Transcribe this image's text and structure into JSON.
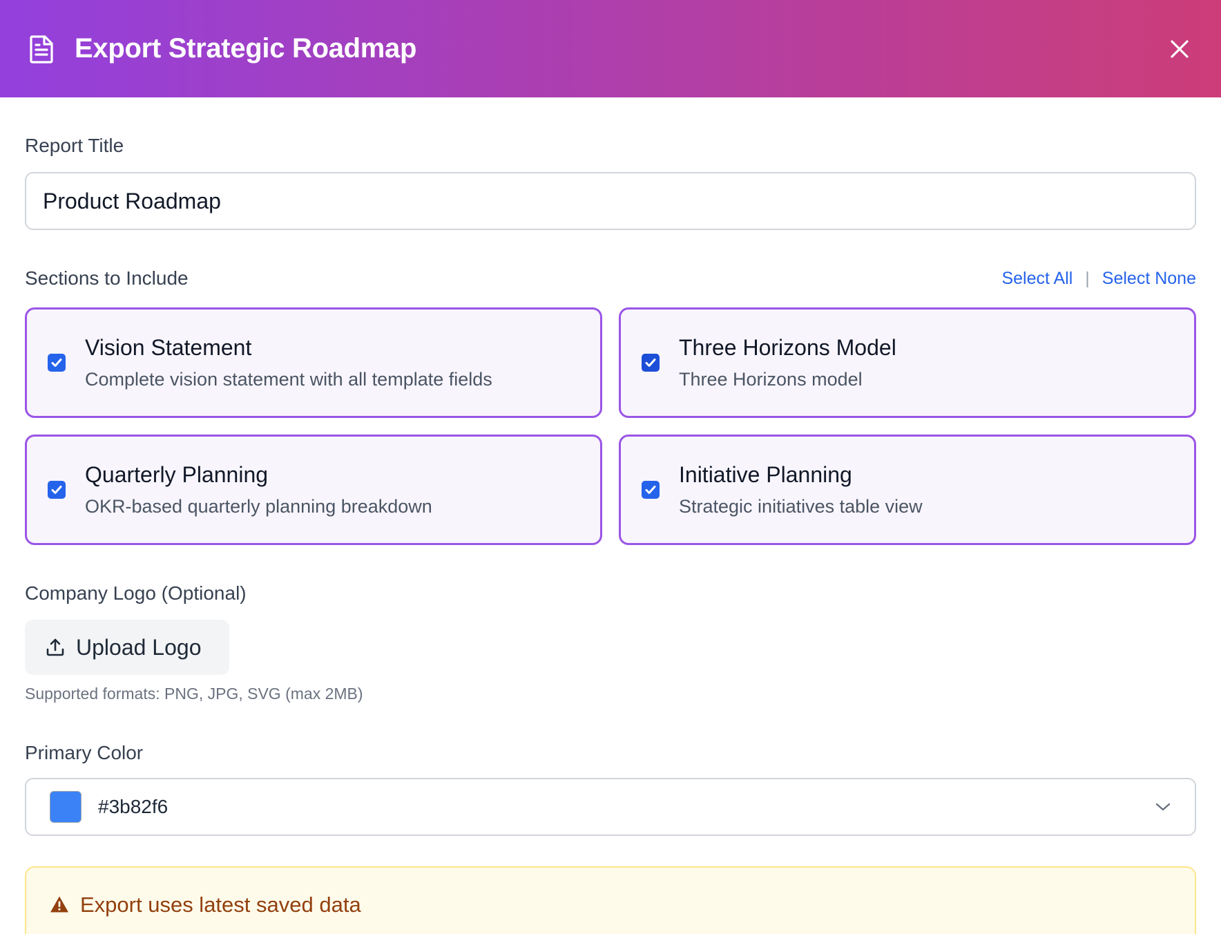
{
  "header": {
    "title": "Export Strategic Roadmap",
    "doc_icon": "document-icon",
    "close_icon": "close-icon"
  },
  "report": {
    "label": "Report Title",
    "value": "Product Roadmap"
  },
  "sections": {
    "label": "Sections to Include",
    "select_all": "Select All",
    "separator": "|",
    "select_none": "Select None",
    "items": [
      {
        "title": "Vision Statement",
        "description": "Complete vision statement with all template fields",
        "checked": true
      },
      {
        "title": "Three Horizons Model",
        "description": "Three Horizons model",
        "checked": true
      },
      {
        "title": "Quarterly Planning",
        "description": "OKR-based quarterly planning breakdown",
        "checked": true
      },
      {
        "title": "Initiative Planning",
        "description": "Strategic initiatives table view",
        "checked": true
      }
    ]
  },
  "logo": {
    "label": "Company Logo (Optional)",
    "button_label": "Upload Logo",
    "button_icon": "upload-icon",
    "hint": "Supported formats: PNG, JPG, SVG (max 2MB)"
  },
  "color": {
    "label": "Primary Color",
    "value": "#3b82f6",
    "swatch": "#3b82f6"
  },
  "notice": {
    "text": "Export uses latest saved data",
    "icon": "warning-icon"
  },
  "theme": {
    "header_gradient_start": "#9340dd",
    "header_gradient_end": "#cc3d78",
    "card_border": "#9a55e6",
    "link": "#2563eb"
  }
}
